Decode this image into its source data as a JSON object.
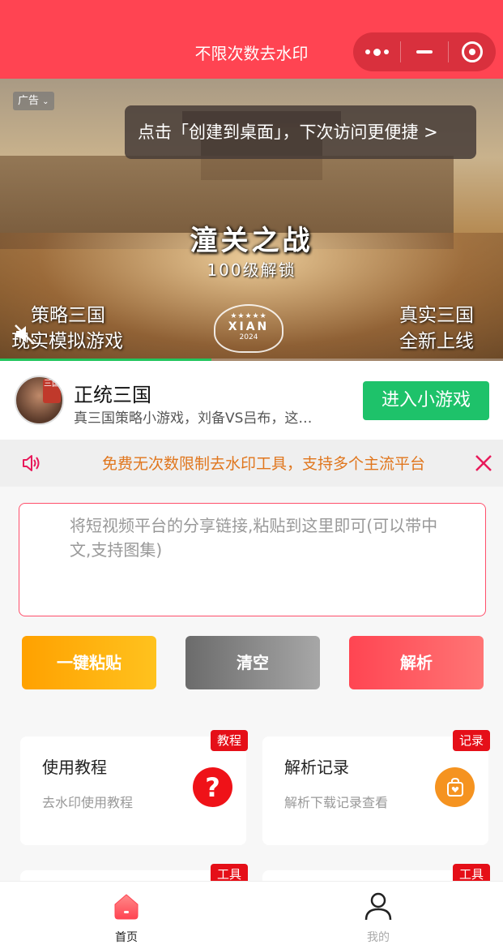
{
  "header": {
    "title": "不限次数去水印"
  },
  "banner": {
    "ad_tag": "广告",
    "shortcut_tip": "点击「创建到桌面」，下次访问更便捷 >",
    "game_title": "潼关之战",
    "game_subtitle": "100级解锁",
    "left_caption_1": "策略三国",
    "left_caption_2": "现实模拟游戏",
    "right_caption_1": "真实三国",
    "right_caption_2": "全新上线",
    "badge_text": "XIAN",
    "badge_year": "2024",
    "video_progress": 0.42
  },
  "mini_game": {
    "name": "正统三国",
    "description": "真三国策略小游戏，刘备VS吕布，这…",
    "enter_label": "进入小游戏",
    "avatar_logo": "三国"
  },
  "notice": {
    "text": "免费无次数限制去水印工具，支持多个主流平台"
  },
  "input": {
    "placeholder": "将短视频平台的分享链接,粘贴到这里即可(可以带中文,支持图集)",
    "value": ""
  },
  "actions": {
    "paste": "一键粘贴",
    "clear": "清空",
    "parse": "解析"
  },
  "cards": [
    {
      "title": "使用教程",
      "subtitle": "去水印使用教程",
      "tag": "教程"
    },
    {
      "title": "解析记录",
      "subtitle": "解析下载记录查看",
      "tag": "记录"
    },
    {
      "title": "",
      "subtitle": "",
      "tag": "工具"
    },
    {
      "title": "",
      "subtitle": "",
      "tag": "工具"
    }
  ],
  "tabbar": {
    "home": "首页",
    "mine": "我的"
  },
  "colors": {
    "brand": "#ff4452",
    "green": "#1ec26a",
    "notice_text": "#e0761d",
    "tag_red": "#e50f18"
  }
}
